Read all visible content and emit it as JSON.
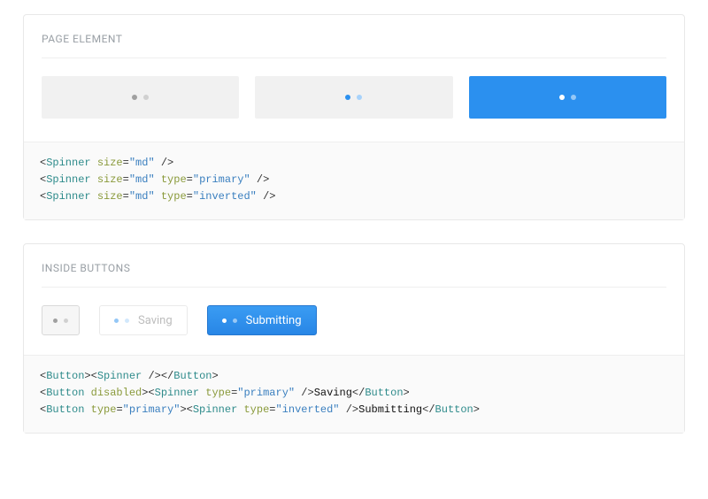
{
  "section1": {
    "title": "PAGE ELEMENT",
    "code": [
      {
        "tag": "Spinner",
        "attrs": [
          {
            "name": "size",
            "value": "md"
          }
        ],
        "selfclose": true
      },
      {
        "tag": "Spinner",
        "attrs": [
          {
            "name": "size",
            "value": "md"
          },
          {
            "name": "type",
            "value": "primary"
          }
        ],
        "selfclose": true
      },
      {
        "tag": "Spinner",
        "attrs": [
          {
            "name": "size",
            "value": "md"
          },
          {
            "name": "type",
            "value": "inverted"
          }
        ],
        "selfclose": true
      }
    ]
  },
  "section2": {
    "title": "INSIDE BUTTONS",
    "buttons": {
      "saving_label": "Saving",
      "submitting_label": "Submitting"
    },
    "code_html": "<span class='p'>&lt;</span><span class='tag'>Button</span><span class='p'>&gt;&lt;</span><span class='tag'>Spinner</span> <span class='p'>/&gt;&lt;/</span><span class='tag'>Button</span><span class='p'>&gt;</span>\n<span class='p'>&lt;</span><span class='tag'>Button</span> <span class='attr'>disabled</span><span class='p'>&gt;&lt;</span><span class='tag'>Spinner</span> <span class='attr'>type</span><span class='eq'>=</span><span class='str'>\"primary\"</span> <span class='p'>/&gt;</span><span class='txt'>Saving</span><span class='p'>&lt;/</span><span class='tag'>Button</span><span class='p'>&gt;</span>\n<span class='p'>&lt;</span><span class='tag'>Button</span> <span class='attr'>type</span><span class='eq'>=</span><span class='str'>\"primary\"</span><span class='p'>&gt;&lt;</span><span class='tag'>Spinner</span> <span class='attr'>type</span><span class='eq'>=</span><span class='str'>\"inverted\"</span> <span class='p'>/&gt;</span><span class='txt'>Submitting</span><span class='p'>&lt;/</span><span class='tag'>Button</span><span class='p'>&gt;</span>"
  }
}
